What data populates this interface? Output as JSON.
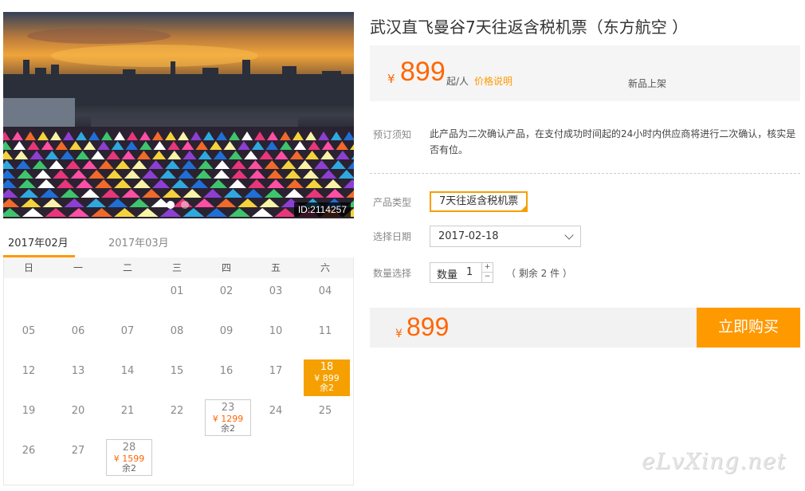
{
  "photo": {
    "id_label": "ID:2114257"
  },
  "calendar": {
    "months": [
      "2017年02月",
      "2017年03月"
    ],
    "weekdays": [
      "日",
      "一",
      "二",
      "三",
      "四",
      "五",
      "六"
    ],
    "days": [
      {
        "n": ""
      },
      {
        "n": ""
      },
      {
        "n": ""
      },
      {
        "n": "01"
      },
      {
        "n": "02"
      },
      {
        "n": "03"
      },
      {
        "n": "04"
      },
      {
        "n": "05"
      },
      {
        "n": "06"
      },
      {
        "n": "07"
      },
      {
        "n": "08"
      },
      {
        "n": "09"
      },
      {
        "n": "10"
      },
      {
        "n": "11"
      },
      {
        "n": "12"
      },
      {
        "n": "13"
      },
      {
        "n": "14"
      },
      {
        "n": "15"
      },
      {
        "n": "16"
      },
      {
        "n": "17"
      },
      {
        "n": "18",
        "price": "¥ 899",
        "left": "余2",
        "selected": true
      },
      {
        "n": "19"
      },
      {
        "n": "20"
      },
      {
        "n": "21"
      },
      {
        "n": "22"
      },
      {
        "n": "23",
        "price": "¥ 1299",
        "left": "余2"
      },
      {
        "n": "24"
      },
      {
        "n": "25"
      },
      {
        "n": "26"
      },
      {
        "n": "27"
      },
      {
        "n": "28",
        "price": "¥ 1599",
        "left": "余2"
      }
    ]
  },
  "product": {
    "title": "武汉直飞曼谷7天往返含税机票（东方航空 ）",
    "currency": "¥",
    "price": "899",
    "unit": "起/人",
    "price_note": "价格说明",
    "status": "新品上架"
  },
  "notice": {
    "label": "预订须知",
    "text": "此产品为二次确认产品，在支付成功时间起的24小时内供应商将进行二次确认，核实是否有位。"
  },
  "options": {
    "type_label": "产品类型",
    "type_value": "7天往返含税机票",
    "date_label": "选择日期",
    "date_value": "2017-02-18",
    "qty_label": "数量选择",
    "qty_inner_label": "数量",
    "qty_value": "1",
    "qty_plus": "+",
    "qty_minus": "−",
    "stock": "（ 剩余 2 件 ）"
  },
  "total": {
    "currency": "¥",
    "price": "899"
  },
  "buy_label": "立即购买",
  "watermark": "eLvXing.net",
  "colors": {
    "accent": "#ff9900",
    "price": "#ff6600"
  }
}
